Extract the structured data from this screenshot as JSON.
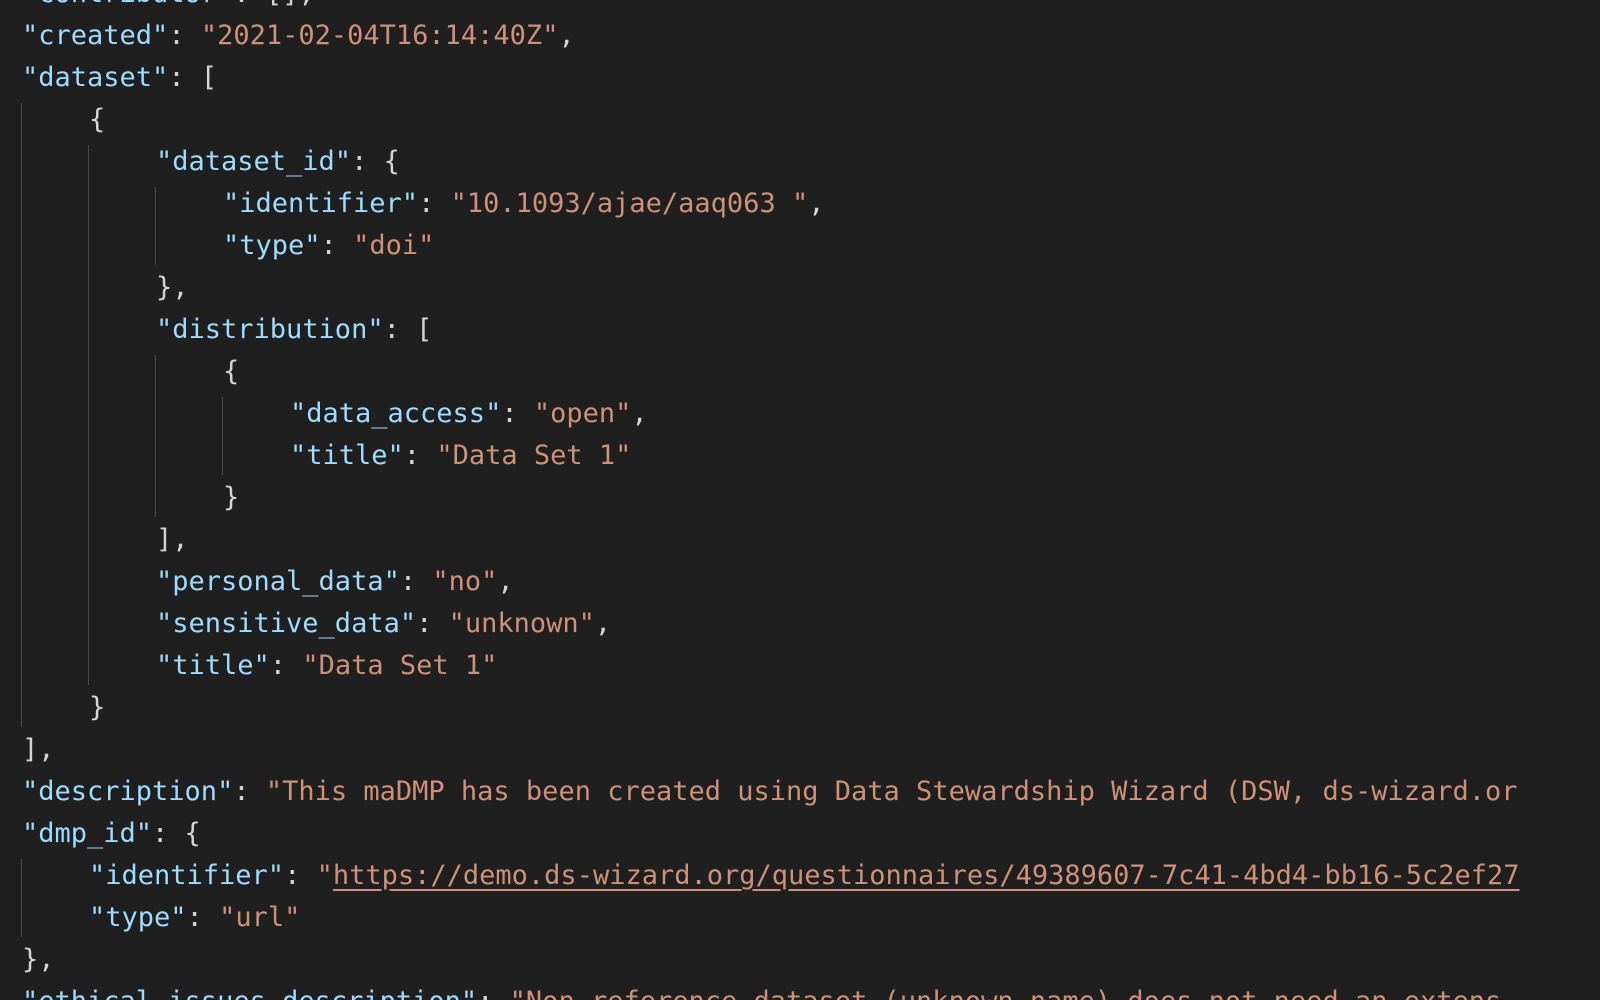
{
  "editor": {
    "colors": {
      "background": "#1f1f1f",
      "key": "#9cdcfe",
      "string": "#ce9178",
      "punctuation": "#d4d4d4",
      "indent_guide": "#4a4a4a"
    },
    "lines": [
      {
        "indent": 0,
        "segments": [
          {
            "kind": "key",
            "text": "\"contributor\""
          },
          {
            "kind": "punct",
            "text": ": [],"
          }
        ]
      },
      {
        "indent": 0,
        "segments": [
          {
            "kind": "key",
            "text": "\"created\""
          },
          {
            "kind": "punct",
            "text": ": "
          },
          {
            "kind": "str",
            "text": "\"2021-02-04T16:14:40Z\""
          },
          {
            "kind": "punct",
            "text": ","
          }
        ]
      },
      {
        "indent": 0,
        "segments": [
          {
            "kind": "key",
            "text": "\"dataset\""
          },
          {
            "kind": "punct",
            "text": ": ["
          }
        ]
      },
      {
        "indent": 1,
        "segments": [
          {
            "kind": "punct",
            "text": "{"
          }
        ]
      },
      {
        "indent": 2,
        "segments": [
          {
            "kind": "key",
            "text": "\"dataset_id\""
          },
          {
            "kind": "punct",
            "text": ": {"
          }
        ]
      },
      {
        "indent": 3,
        "segments": [
          {
            "kind": "key",
            "text": "\"identifier\""
          },
          {
            "kind": "punct",
            "text": ": "
          },
          {
            "kind": "str",
            "text": "\"10.1093/ajae/aaq063 \""
          },
          {
            "kind": "punct",
            "text": ","
          }
        ]
      },
      {
        "indent": 3,
        "segments": [
          {
            "kind": "key",
            "text": "\"type\""
          },
          {
            "kind": "punct",
            "text": ": "
          },
          {
            "kind": "str",
            "text": "\"doi\""
          }
        ]
      },
      {
        "indent": 2,
        "segments": [
          {
            "kind": "punct",
            "text": "},"
          }
        ]
      },
      {
        "indent": 2,
        "segments": [
          {
            "kind": "key",
            "text": "\"distribution\""
          },
          {
            "kind": "punct",
            "text": ": ["
          }
        ]
      },
      {
        "indent": 3,
        "segments": [
          {
            "kind": "punct",
            "text": "{"
          }
        ]
      },
      {
        "indent": 4,
        "segments": [
          {
            "kind": "key",
            "text": "\"data_access\""
          },
          {
            "kind": "punct",
            "text": ": "
          },
          {
            "kind": "str",
            "text": "\"open\""
          },
          {
            "kind": "punct",
            "text": ","
          }
        ]
      },
      {
        "indent": 4,
        "segments": [
          {
            "kind": "key",
            "text": "\"title\""
          },
          {
            "kind": "punct",
            "text": ": "
          },
          {
            "kind": "str",
            "text": "\"Data Set 1\""
          }
        ]
      },
      {
        "indent": 3,
        "segments": [
          {
            "kind": "punct",
            "text": "}"
          }
        ]
      },
      {
        "indent": 2,
        "segments": [
          {
            "kind": "punct",
            "text": "],"
          }
        ]
      },
      {
        "indent": 2,
        "segments": [
          {
            "kind": "key",
            "text": "\"personal_data\""
          },
          {
            "kind": "punct",
            "text": ": "
          },
          {
            "kind": "str",
            "text": "\"no\""
          },
          {
            "kind": "punct",
            "text": ","
          }
        ]
      },
      {
        "indent": 2,
        "segments": [
          {
            "kind": "key",
            "text": "\"sensitive_data\""
          },
          {
            "kind": "punct",
            "text": ": "
          },
          {
            "kind": "str",
            "text": "\"unknown\""
          },
          {
            "kind": "punct",
            "text": ","
          }
        ]
      },
      {
        "indent": 2,
        "segments": [
          {
            "kind": "key",
            "text": "\"title\""
          },
          {
            "kind": "punct",
            "text": ": "
          },
          {
            "kind": "str",
            "text": "\"Data Set 1\""
          }
        ]
      },
      {
        "indent": 1,
        "segments": [
          {
            "kind": "punct",
            "text": "}"
          }
        ]
      },
      {
        "indent": 0,
        "segments": [
          {
            "kind": "punct",
            "text": "],"
          }
        ]
      },
      {
        "indent": 0,
        "segments": [
          {
            "kind": "key",
            "text": "\"description\""
          },
          {
            "kind": "punct",
            "text": ": "
          },
          {
            "kind": "str",
            "text": "\"This maDMP has been created using Data Stewardship Wizard (DSW, ds-wizard.or"
          }
        ]
      },
      {
        "indent": 0,
        "segments": [
          {
            "kind": "key",
            "text": "\"dmp_id\""
          },
          {
            "kind": "punct",
            "text": ": {"
          }
        ]
      },
      {
        "indent": 1,
        "segments": [
          {
            "kind": "key",
            "text": "\"identifier\""
          },
          {
            "kind": "punct",
            "text": ": "
          },
          {
            "kind": "str",
            "text": "\""
          },
          {
            "kind": "link",
            "text": "https://demo.ds-wizard.org/questionnaires/49389607-7c41-4bd4-bb16-5c2ef27"
          }
        ]
      },
      {
        "indent": 1,
        "segments": [
          {
            "kind": "key",
            "text": "\"type\""
          },
          {
            "kind": "punct",
            "text": ": "
          },
          {
            "kind": "str",
            "text": "\"url\""
          }
        ]
      },
      {
        "indent": 0,
        "segments": [
          {
            "kind": "punct",
            "text": "},"
          }
        ]
      },
      {
        "indent": 0,
        "segments": [
          {
            "kind": "key",
            "text": "\"ethical_issues_description\""
          },
          {
            "kind": "punct",
            "text": ": "
          },
          {
            "kind": "str",
            "text": "\"Non-reference dataset (unknown name) does not need an extens"
          }
        ]
      }
    ]
  }
}
